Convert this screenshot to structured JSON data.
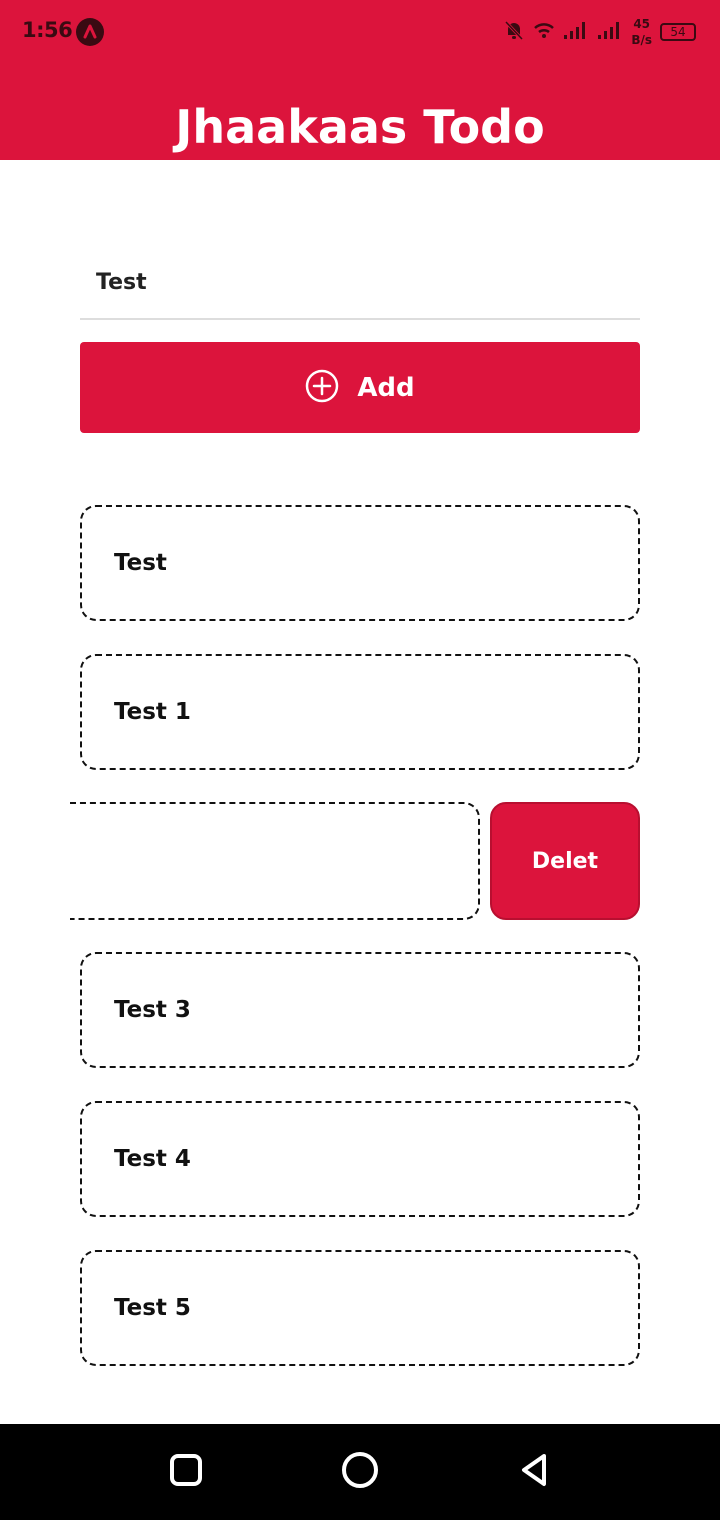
{
  "status_bar": {
    "time": "1:56",
    "net_speed_value": "45",
    "net_speed_unit": "B/s",
    "battery": "54"
  },
  "header": {
    "title": "Jhaakaas Todo"
  },
  "form": {
    "input_value": "Test",
    "add_label": "Add"
  },
  "todos": [
    {
      "text": "Test"
    },
    {
      "text": "Test 1"
    },
    {
      "text": "Test 3"
    },
    {
      "text": "Test 4"
    },
    {
      "text": "Test 5"
    }
  ],
  "swiped": {
    "action_label": "Delet"
  },
  "colors": {
    "accent": "#dc143c",
    "nav_bar": "#000000"
  },
  "icons": {
    "add": "plus-circle-icon",
    "nav_recents": "square-icon",
    "nav_home": "circle-icon",
    "nav_back": "triangle-back-icon"
  }
}
